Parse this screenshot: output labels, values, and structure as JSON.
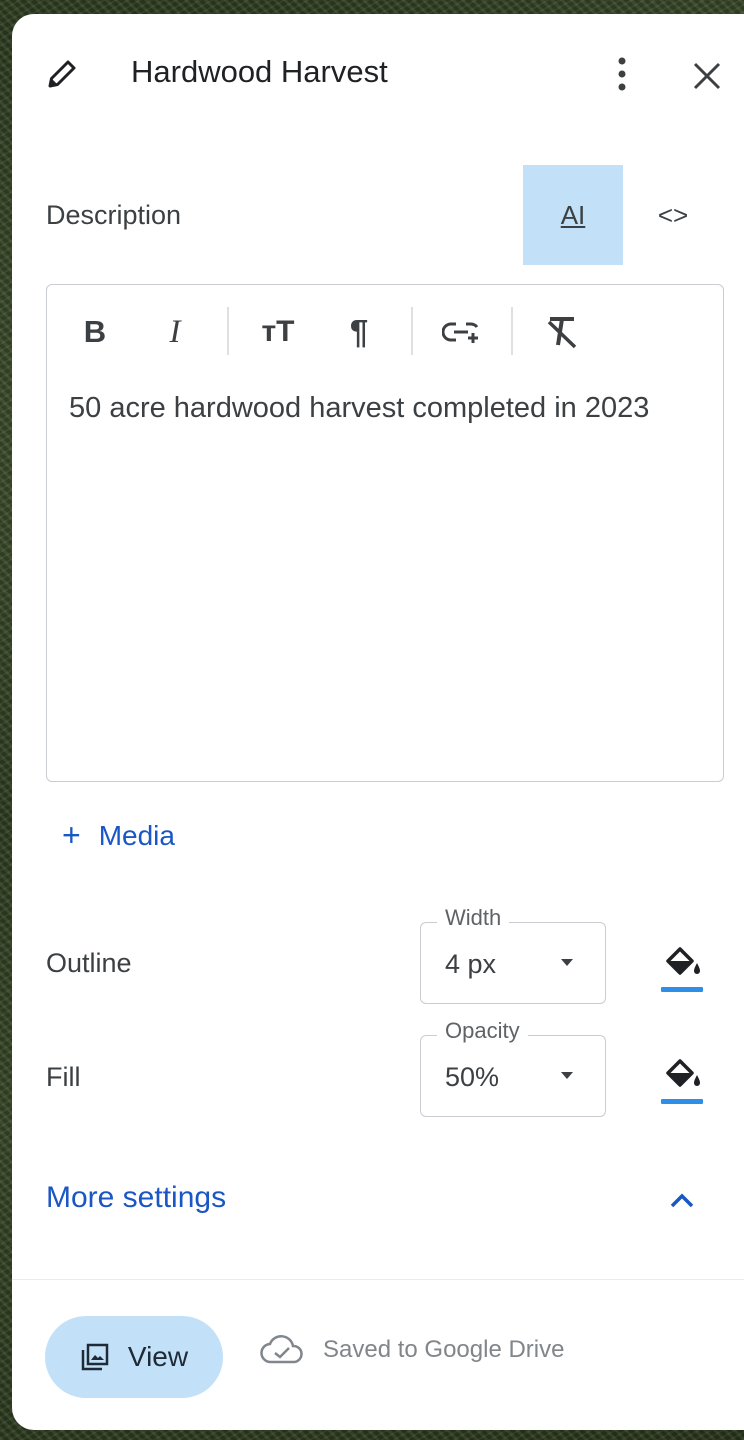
{
  "header": {
    "title": "Hardwood Harvest",
    "icons": {
      "edit": "pencil-icon",
      "menu": "more-vert-icon",
      "close": "close-icon"
    }
  },
  "description": {
    "label": "Description",
    "ai_label": "AI",
    "code_label": "<>",
    "text": "50 acre hardwood harvest completed in 2023",
    "toolbar": [
      "bold-icon",
      "italic-icon",
      "text-size-icon",
      "paragraph-icon",
      "add-link-icon",
      "clear-format-icon"
    ],
    "toolbar_labels": {
      "bold": "B",
      "italic": "I",
      "size": "тT",
      "paragraph": "¶"
    }
  },
  "media": {
    "plus": "+",
    "label": "Media"
  },
  "outline": {
    "label": "Outline",
    "field_label": "Width",
    "value": "4 px",
    "color": "#2f8ee8"
  },
  "fill": {
    "label": "Fill",
    "field_label": "Opacity",
    "value": "50%",
    "color": "#2f8ee8"
  },
  "more_settings": {
    "label": "More settings",
    "expanded": true
  },
  "footer": {
    "view_label": "View",
    "saved_text": "Saved to Google Drive"
  },
  "colors": {
    "accent": "#1a57c4",
    "highlight": "#c2e1f9"
  }
}
